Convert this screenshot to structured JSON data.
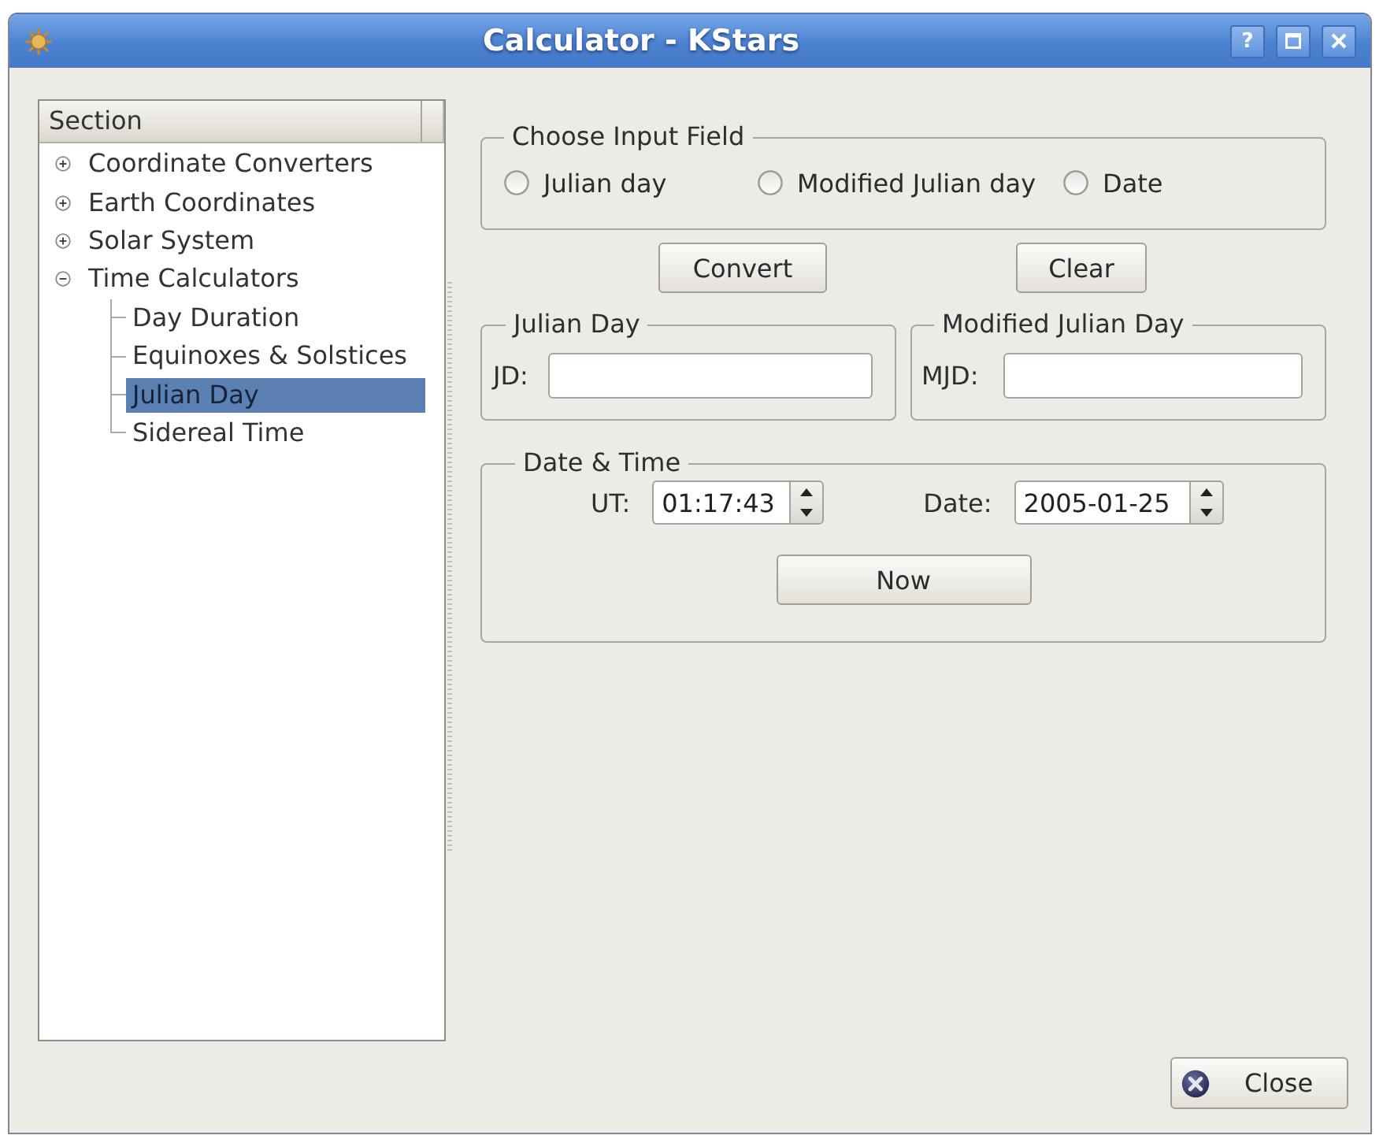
{
  "window": {
    "title": "Calculator - KStars",
    "help_button": "?"
  },
  "tree": {
    "header": "Section",
    "items": [
      {
        "label": "Coordinate Converters",
        "expanded": false,
        "selected": false
      },
      {
        "label": "Earth Coordinates",
        "expanded": false,
        "selected": false
      },
      {
        "label": "Solar System",
        "expanded": false,
        "selected": false
      },
      {
        "label": "Time Calculators",
        "expanded": true,
        "selected": false,
        "children": [
          {
            "label": "Day Duration",
            "selected": false
          },
          {
            "label": "Equinoxes & Solstices",
            "selected": false
          },
          {
            "label": "Julian Day",
            "selected": true
          },
          {
            "label": "Sidereal Time",
            "selected": false
          }
        ]
      }
    ]
  },
  "input_choice": {
    "title": "Choose Input Field",
    "options": [
      {
        "label": "Julian day",
        "selected": false
      },
      {
        "label": "Modified Julian day",
        "selected": false
      },
      {
        "label": "Date",
        "selected": false
      }
    ]
  },
  "actions": [
    {
      "label": "Convert"
    },
    {
      "label": "Clear"
    }
  ],
  "julian_day": {
    "title": "Julian Day",
    "field_label": "JD:"
  },
  "modified_julian_day": {
    "title": "Modified Julian Day",
    "field_label": "MJD:"
  },
  "date_time": {
    "title": "Date & Time",
    "ut_label": "UT:",
    "ut_value": "01:17:43",
    "date_label": "Date:",
    "date_value": "2005-01-25",
    "now_button": {
      "label": "Now"
    }
  },
  "close_button": {
    "label": "Close"
  }
}
